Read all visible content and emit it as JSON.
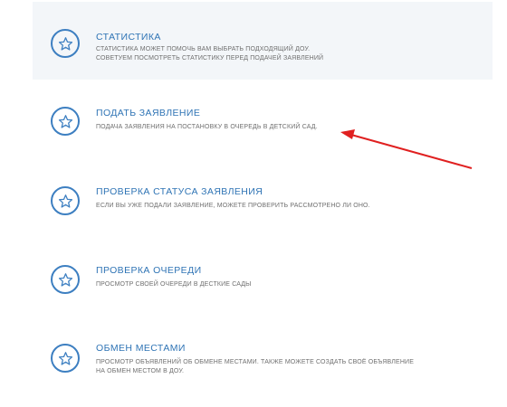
{
  "menu": {
    "items": [
      {
        "title": "СТАТИСТИКА",
        "description": "СТАТИСТИКА МОЖЕТ ПОМОЧЬ ВАМ ВЫБРАТЬ ПОДХОДЯЩИЙ ДОУ.\nСОВЕТУЕМ ПОСМОТРЕТЬ СТАТИСТИКУ ПЕРЕД ПОДАЧЕЙ ЗАЯВЛЕНИЙ",
        "icon": "star-icon"
      },
      {
        "title": "ПОДАТЬ ЗАЯВЛЕНИЕ",
        "description": "ПОДАЧА ЗАЯВЛЕНИЯ НА ПОСТАНОВКУ В ОЧЕРЕДЬ В ДЕТСКИЙ САД.",
        "icon": "star-icon"
      },
      {
        "title": "ПРОВЕРКА СТАТУСА ЗАЯВЛЕНИЯ",
        "description": "ЕСЛИ ВЫ УЖЕ ПОДАЛИ ЗАЯВЛЕНИЕ, МОЖЕТЕ ПРОВЕРИТЬ РАССМОТРЕНО ЛИ ОНО.",
        "icon": "star-icon"
      },
      {
        "title": "ПРОВЕРКА ОЧЕРЕДИ",
        "description": "ПРОСМОТР СВОЕЙ ОЧЕРЕДИ В ДЕСТКИЕ САДЫ",
        "icon": "star-icon"
      },
      {
        "title": "ОБМЕН МЕСТАМИ",
        "description": "ПРОСМОТР ОБЪЯВЛЕНИЙ ОБ ОБМЕНЕ МЕСТАМИ. ТАКЖЕ МОЖЕТЕ СОЗДАТЬ СВОЁ ОБЪЯВЛЕНИЕ\nНА ОБМЕН МЕСТОМ В ДОУ.",
        "icon": "star-icon"
      }
    ]
  },
  "annotation": {
    "arrow_color": "#e02020",
    "arrow_icon": "red-arrow-annotation"
  },
  "colors": {
    "accent": "#2f74b5",
    "icon_border": "#3d7fc1",
    "description": "#6f6f6f",
    "highlight_bg": "#f3f6f9"
  }
}
